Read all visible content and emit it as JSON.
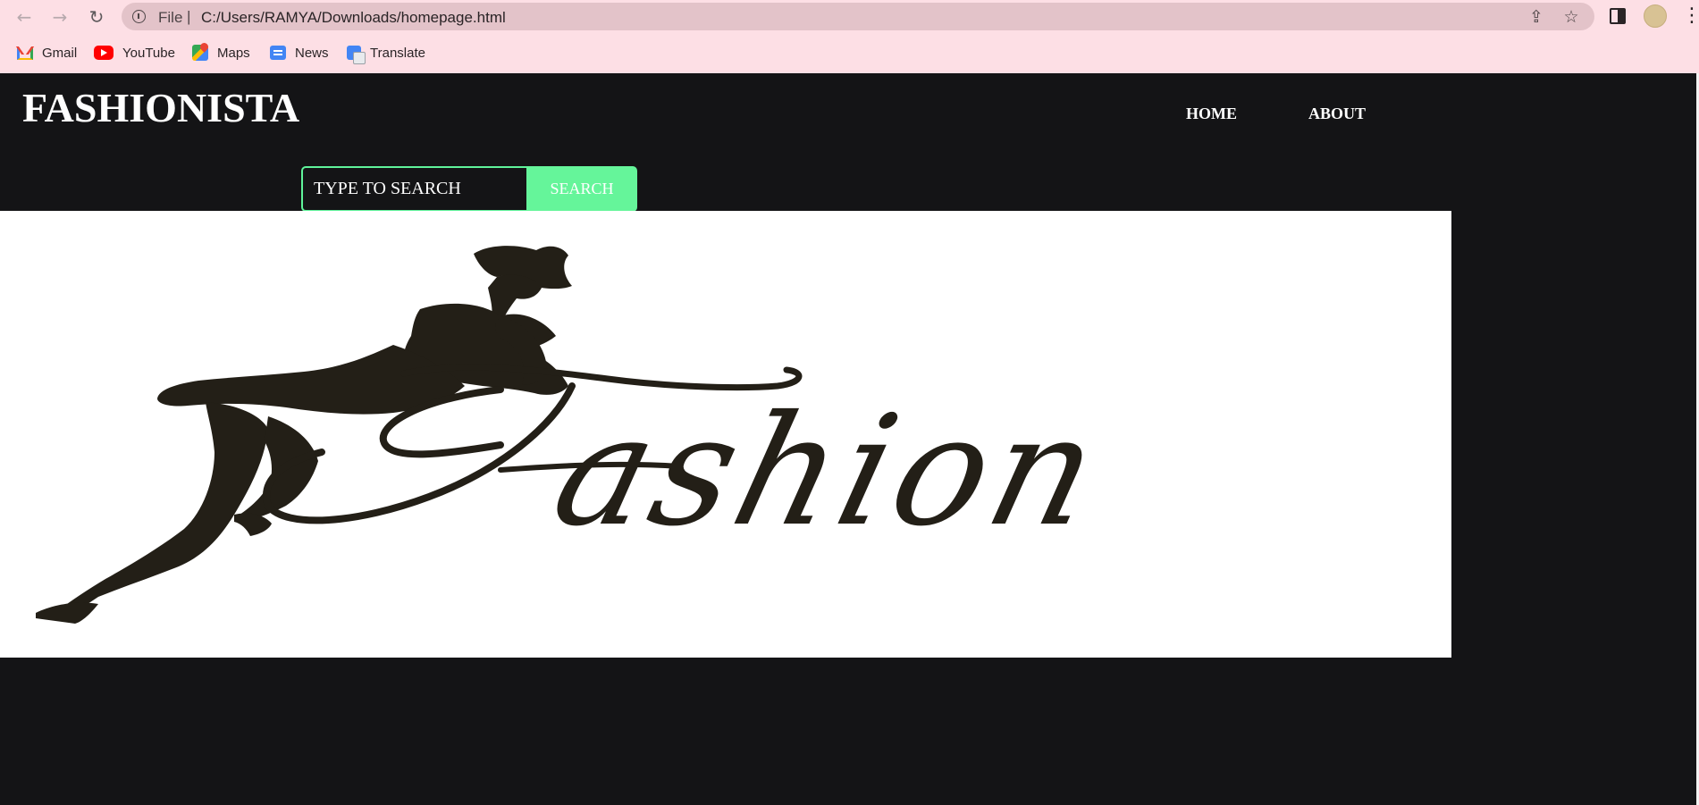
{
  "browser": {
    "url_scheme": "File",
    "url": "C:/Users/RAMYA/Downloads/homepage.html",
    "nav_icons": [
      "back-arrow-icon",
      "forward-arrow-icon",
      "reload-icon"
    ],
    "omnibox_icons": [
      "site-info-icon",
      "share-icon",
      "bookmark-star-icon"
    ],
    "bookmarks": [
      {
        "label": "Gmail",
        "icon": "gmail-icon"
      },
      {
        "label": "YouTube",
        "icon": "youtube-icon"
      },
      {
        "label": "Maps",
        "icon": "maps-icon"
      },
      {
        "label": "News",
        "icon": "news-icon"
      },
      {
        "label": "Translate",
        "icon": "translate-icon"
      }
    ]
  },
  "page": {
    "brand": "FASHIONISTA",
    "nav": {
      "home": "HOME",
      "about": "ABOUT"
    },
    "search": {
      "placeholder": "TYPE TO SEARCH",
      "button": "SEARCH"
    },
    "hero_image": {
      "description_icon": "fashion-logo-image"
    },
    "colors": {
      "background": "#141416",
      "accent": "#65f59a",
      "chrome": "#fddfe5"
    }
  }
}
